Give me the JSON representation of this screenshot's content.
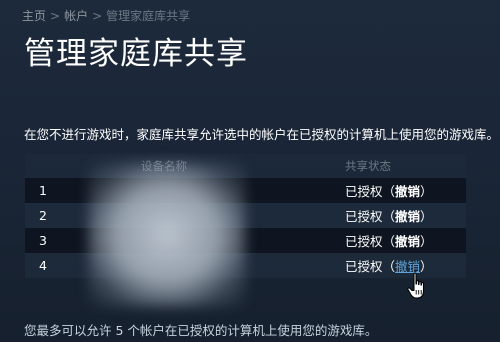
{
  "breadcrumb": {
    "home": "主页",
    "account": "帐户",
    "current": "管理家庭库共享",
    "separator": ">"
  },
  "page_title": "管理家庭库共享",
  "description": "在您不进行游戏时，家庭库共享允许选中的帐户在已授权的计算机上使用您的游戏库。",
  "table": {
    "headers": {
      "device_name": "设备名称",
      "share_status": "共享状态"
    },
    "rows": [
      {
        "num": "1",
        "status": "已授权",
        "open": "（",
        "revoke": "撤销",
        "close": "）"
      },
      {
        "num": "2",
        "status": "已授权",
        "open": "（",
        "revoke": "撤销",
        "close": "）"
      },
      {
        "num": "3",
        "status": "已授权",
        "open": "（",
        "revoke": "撤销",
        "close": "）"
      },
      {
        "num": "4",
        "status": "已授权",
        "open": "（",
        "revoke": "撤销",
        "close": "）"
      }
    ]
  },
  "footer_note": "您最多可以允许 5 个帐户在已授权的计算机上使用您的游戏库。",
  "colors": {
    "background": "#1b2838",
    "link_hover": "#5fa3d8",
    "muted_text": "#8f98a0"
  },
  "icons": {
    "cursor": "hand-pointer-icon"
  }
}
